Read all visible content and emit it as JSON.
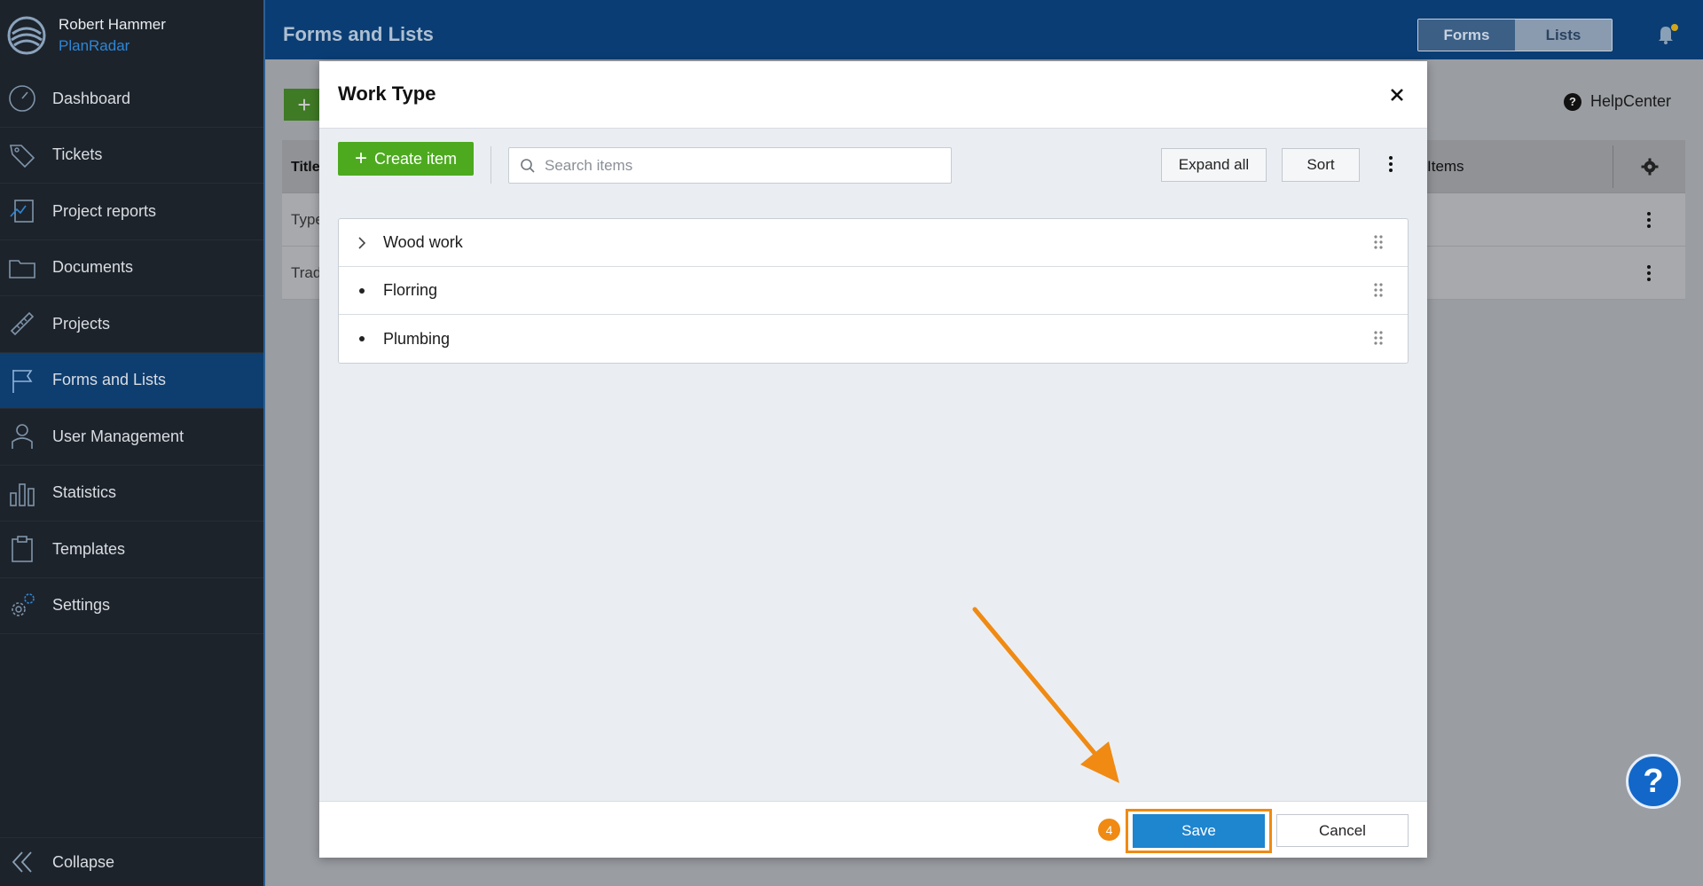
{
  "user": {
    "name": "Robert Hammer",
    "brand": "PlanRadar"
  },
  "sidebar": {
    "items": [
      {
        "label": "Dashboard",
        "icon": "dashboard-icon"
      },
      {
        "label": "Tickets",
        "icon": "tag-icon"
      },
      {
        "label": "Project reports",
        "icon": "report-icon"
      },
      {
        "label": "Documents",
        "icon": "folder-icon"
      },
      {
        "label": "Projects",
        "icon": "ruler-icon"
      },
      {
        "label": "Forms and Lists",
        "icon": "flag-icon",
        "active": true
      },
      {
        "label": "User Management",
        "icon": "user-icon"
      },
      {
        "label": "Statistics",
        "icon": "bar-chart-icon"
      },
      {
        "label": "Templates",
        "icon": "clipboard-icon"
      },
      {
        "label": "Settings",
        "icon": "gear-icon"
      }
    ],
    "collapse_label": "Collapse"
  },
  "header": {
    "title": "Forms and Lists",
    "toggle": {
      "forms": "Forms",
      "lists": "Lists"
    }
  },
  "background": {
    "help_label": "HelpCenter",
    "table": {
      "col_title": "Title",
      "col_items": "Items",
      "rows": [
        "Type",
        "Trad"
      ]
    }
  },
  "modal": {
    "title": "Work Type",
    "create_label": "Create item",
    "search_placeholder": "Search items",
    "expand_all_label": "Expand all",
    "sort_label": "Sort",
    "items": [
      {
        "label": "Wood work",
        "expandable": true
      },
      {
        "label": "Florring",
        "expandable": false
      },
      {
        "label": "Plumbing",
        "expandable": false
      }
    ],
    "save_label": "Save",
    "cancel_label": "Cancel",
    "step_number": "4"
  },
  "colors": {
    "accent": "#1e85cf",
    "create_green": "#4daa1f",
    "highlight_orange": "#f08a12",
    "header_blue": "#0a3d74",
    "sidebar_bg": "#1d232b"
  }
}
